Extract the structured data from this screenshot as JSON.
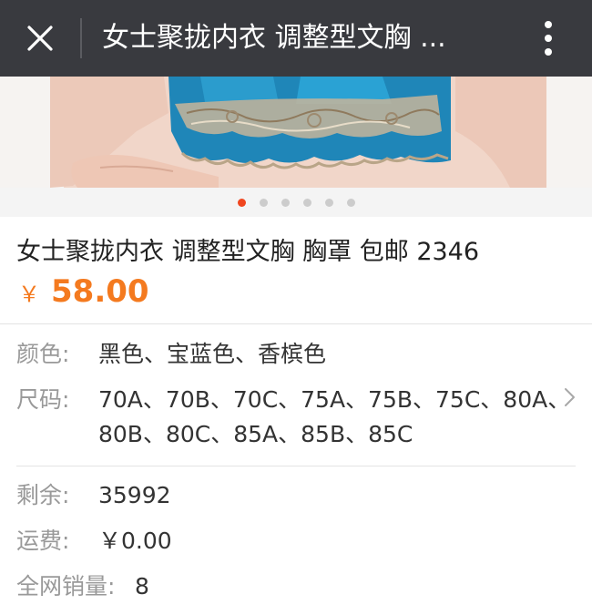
{
  "topbar": {
    "title": "女士聚拢内衣 调整型文胸 ...",
    "close_icon": "close-icon",
    "menu_icon": "more-vertical-icon",
    "background": "#393a3f"
  },
  "gallery": {
    "image_count": 6,
    "active_index": 0,
    "active_color": "#f0461f"
  },
  "product": {
    "title": "女士聚拢内衣 调整型文胸 胸罩 包邮 2346",
    "price_symbol": "￥",
    "price": "58.00",
    "price_color": "#f47a1f"
  },
  "specs": {
    "color_label": "颜色:",
    "color_value": "黑色、宝蓝色、香槟色",
    "size_label": "尺码:",
    "size_line1": "70A、70B、70C、75A、75B、75C、80A、",
    "size_line2": "80B、80C、85A、85B、85C",
    "chevron_icon": "chevron-right-icon"
  },
  "meta": {
    "stock_label": "剩余:",
    "stock_value": "35992",
    "shipping_label": "运费:",
    "shipping_value": "￥0.00",
    "sales_label": "全网销量:",
    "sales_value": "8"
  }
}
